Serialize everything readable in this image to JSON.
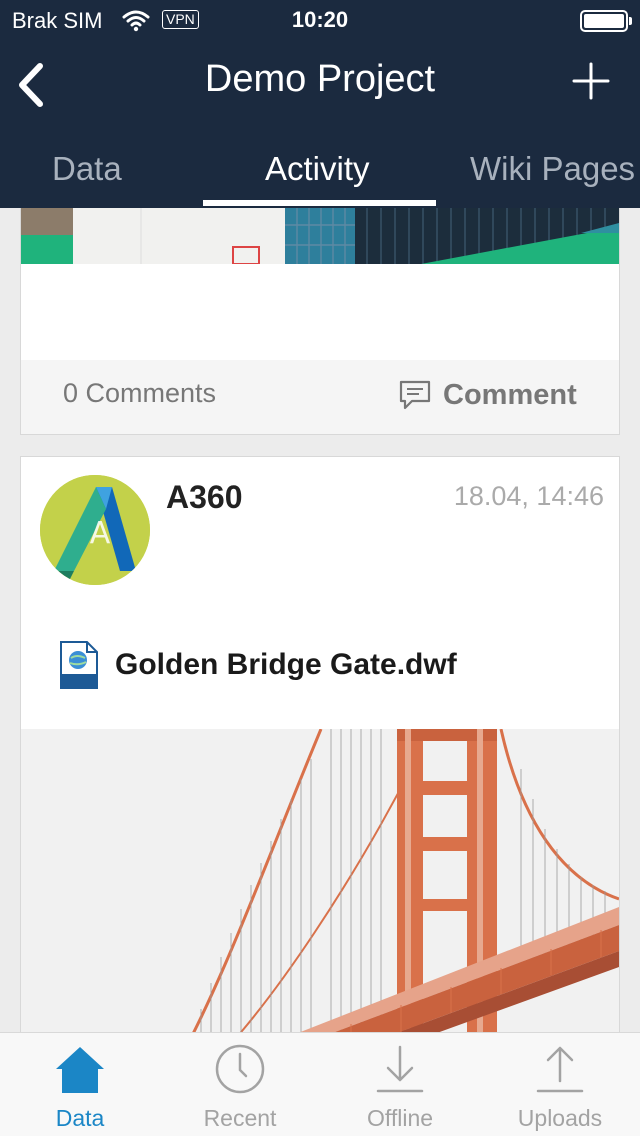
{
  "status_bar": {
    "carrier": "Brak SIM",
    "vpn": "VPN",
    "time": "10:20"
  },
  "header": {
    "title": "Demo Project",
    "back_icon": "chevron-left-icon",
    "add_icon": "plus-icon"
  },
  "tabs": [
    {
      "label": "Data",
      "active": false
    },
    {
      "label": "Activity",
      "active": true
    },
    {
      "label": "Wiki Pages",
      "active": false
    }
  ],
  "feed": [
    {
      "comments_label": "0 Comments",
      "comment_button_label": "Comment"
    },
    {
      "author": "A360",
      "timestamp": "18.04, 14:46",
      "file_name": "Golden Bridge Gate.dwf",
      "avatar_letter": "A"
    }
  ],
  "bottom_tabs": [
    {
      "label": "Data",
      "icon": "home-icon",
      "active": true
    },
    {
      "label": "Recent",
      "icon": "clock-icon",
      "active": false
    },
    {
      "label": "Offline",
      "icon": "download-icon",
      "active": false
    },
    {
      "label": "Uploads",
      "icon": "upload-icon",
      "active": false
    }
  ],
  "colors": {
    "header_bg": "#1b2a3f",
    "accent": "#1b86c6",
    "bridge": "#d9714a"
  }
}
